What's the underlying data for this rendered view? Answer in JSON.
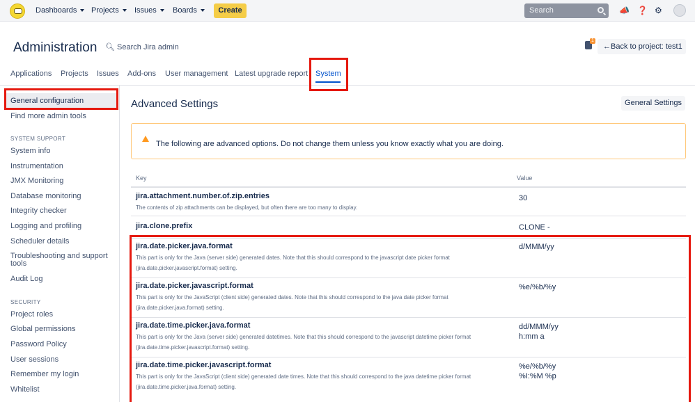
{
  "topnav": {
    "items": [
      "Dashboards",
      "Projects",
      "Issues",
      "Boards"
    ],
    "create_label": "Create",
    "search_placeholder": "Search"
  },
  "header": {
    "title": "Administration",
    "admin_search": "Search Jira admin",
    "notification_count": "1",
    "back_button": "Back to project: test1",
    "tabs": [
      "Applications",
      "Projects",
      "Issues",
      "Add-ons",
      "User management",
      "Latest upgrade report",
      "System"
    ],
    "active_tab": "System"
  },
  "sidebar": {
    "selected": "General configuration",
    "top_items": [
      "General configuration",
      "Find more admin tools"
    ],
    "sections": [
      {
        "heading": "SYSTEM SUPPORT",
        "items": [
          "System info",
          "Instrumentation",
          "JMX Monitoring",
          "Database monitoring",
          "Integrity checker",
          "Logging and profiling",
          "Scheduler details",
          "Troubleshooting and support tools",
          "Audit Log"
        ]
      },
      {
        "heading": "SECURITY",
        "items": [
          "Project roles",
          "Global permissions",
          "Password Policy",
          "User sessions",
          "Remember my login",
          "Whitelist"
        ]
      }
    ]
  },
  "main": {
    "title": "Advanced Settings",
    "general_settings_button": "General Settings",
    "warning": "The following are advanced options. Do not change them unless you know exactly what you are doing.",
    "columns": [
      "Key",
      "Value"
    ],
    "rows": [
      {
        "key": "jira.attachment.number.of.zip.entries",
        "desc": "The contents of zip attachments can be displayed, but often there are too many to display.",
        "value": "30"
      },
      {
        "key": "jira.clone.prefix",
        "desc": "",
        "value": "CLONE -"
      },
      {
        "key": "jira.date.picker.java.format",
        "desc": "This part is only for the Java (server side) generated dates. Note that this should correspond to the javascript date picker format (jira.date.picker.javascript.format) setting.",
        "value": "d/MMM/yy"
      },
      {
        "key": "jira.date.picker.javascript.format",
        "desc": "This part is only for the JavaScript (client side) generated dates. Note that this should correspond to the java date picker format (jira.date.picker.java.format) setting.",
        "value": "%e/%b/%y"
      },
      {
        "key": "jira.date.time.picker.java.format",
        "desc": "This part is only for the Java (server side) generated datetimes. Note that this should correspond to the javascript datetime picker format (jira.date.time.picker.javascript.format) setting.",
        "value": "dd/MMM/yy\nh:mm a"
      },
      {
        "key": "jira.date.time.picker.javascript.format",
        "desc": "This part is only for the JavaScript (client side) generated date times. Note that this should correspond to the java datetime picker format (jira.date.time.picker.java.format) setting.",
        "value": "%e/%b/%y\n%I:%M %p"
      }
    ]
  },
  "colors": {
    "highlight_box": "#e5190f",
    "accent": "#0052cc",
    "create_button": "#f5cd47",
    "warning_border": "#ffc87a"
  }
}
